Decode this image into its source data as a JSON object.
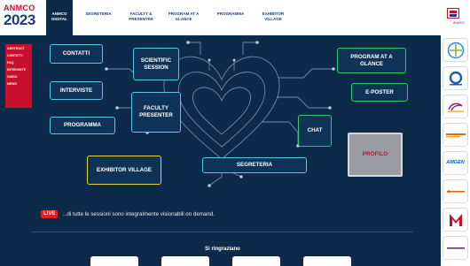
{
  "header": {
    "logo_brand": "ANMCO",
    "logo_year": "2023",
    "nav": [
      {
        "label": "ANMCO DIGITAL",
        "active": true
      },
      {
        "label": "SEGRETERIA",
        "active": false
      },
      {
        "label": "FACULTY & PRESENTER",
        "active": false
      },
      {
        "label": "PROGRAM AT A GLANCE",
        "active": false
      },
      {
        "label": "PROGRAMMA",
        "active": false
      },
      {
        "label": "EXHIBITOR VILLAGE",
        "active": false
      }
    ],
    "account_label": "ANMCO"
  },
  "sidebar": {
    "items": [
      "ABSTRACT",
      "CONTATTI",
      "FAQ",
      "INTERVISTE",
      "GUIDA",
      "NEWS"
    ]
  },
  "tiles": {
    "contatti": "CONTATTI",
    "scientific_session": "SCIENTIFIC SESSION",
    "interviste": "INTERVISTE",
    "faculty_presenter": "FACULTY PRESENTER",
    "programma": "PROGRAMMA",
    "exhibitor_village": "EXHIBITOR VILLAGE",
    "segreteria": "SEGRETERIA",
    "program_at_a_glance": "PROGRAM AT A GLANCE",
    "e_poster": "E-POSTER",
    "chat": "CHAT",
    "profilo": "PROFILO"
  },
  "live": {
    "badge": "LIVE",
    "text": "...di tutte le sessioni sono integralmente visionabili on demand."
  },
  "thanks": {
    "title": "Si ringraziano"
  },
  "sponsors": {
    "items": [
      {
        "name": "Bayer",
        "icon": "cross-logo-icon",
        "color": "#2a8dd1"
      },
      {
        "name": "Daiichi-Sankyo",
        "icon": "ring-logo-icon",
        "color": "#1d5fa8"
      },
      {
        "name": "AstraZeneca",
        "icon": "swirl-logo-icon",
        "color": "#8a1c6b"
      },
      {
        "name": "Boehringer Ingelheim",
        "icon": "wordmark-icon",
        "color": "#e0651f"
      },
      {
        "name": "AMGEN",
        "icon": "wordmark-icon",
        "color": "#0063c3"
      },
      {
        "name": "Servier",
        "icon": "wordmark-icon",
        "color": "#e0651f"
      },
      {
        "name": "Menarini",
        "icon": "m-logo-icon",
        "color": "#c8102e"
      },
      {
        "name": "sanofi",
        "icon": "wordmark-icon",
        "color": "#5b2d91"
      }
    ],
    "amgen_label": "AMGEN"
  },
  "colors": {
    "background": "#0c2a4a",
    "tile_border_blue": "#58c7ea",
    "tile_border_green": "#32c86e",
    "tile_border_yellow": "#e9d33c",
    "accent_red": "#c8102e"
  }
}
